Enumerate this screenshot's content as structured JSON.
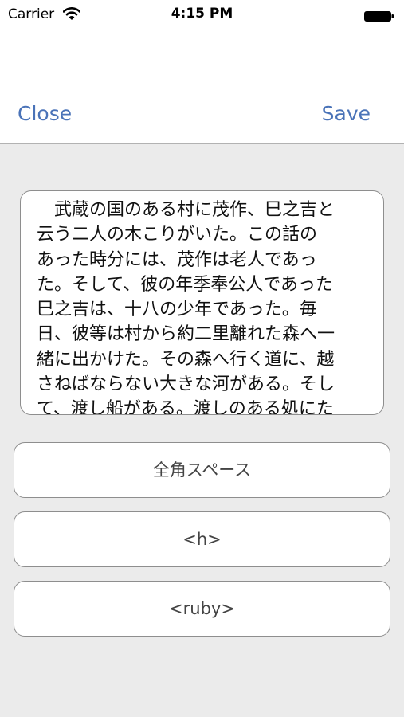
{
  "status_bar": {
    "carrier": "Carrier",
    "time": "4:15 PM",
    "wifi_icon": "wifi-icon",
    "battery_icon": "battery-icon"
  },
  "nav": {
    "close_label": "Close",
    "save_label": "Save",
    "accent_color": "#4a73b8"
  },
  "editor": {
    "lines": [
      "　武蔵の国のある村に茂作、巳之吉と",
      "云う二人の木こりがいた。この話の",
      "あった時分には、茂作は老人であっ",
      "た。そして、彼の年季奉公人であった",
      "巳之吉は、十八の少年であった。毎",
      "日、彼等は村から約二里離れた森へ一",
      "緒に出かけた。その森へ行く道に、越",
      "さねばならない大きな河がある。そし",
      "て、渡し船がある。渡しのある処にた"
    ]
  },
  "buttons": {
    "fullwidth_space": "全角スペース",
    "h_tag": "<h>",
    "ruby_tag": "<ruby>"
  }
}
